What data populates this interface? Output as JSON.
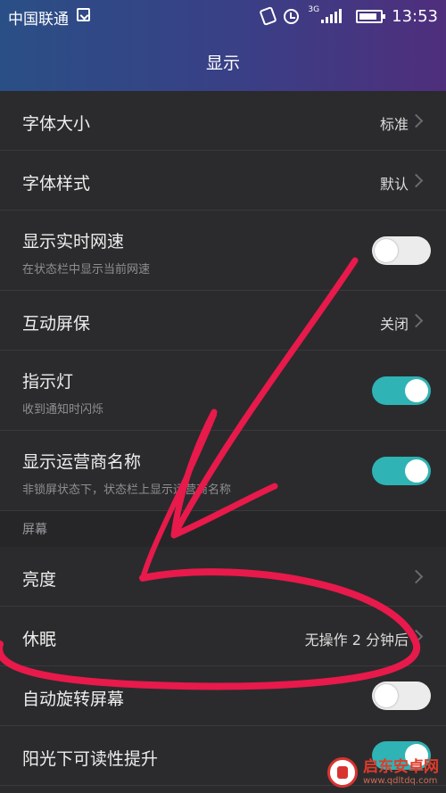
{
  "status_bar": {
    "carrier": "中国联通",
    "network_type": "3G",
    "time": "13:53",
    "battery_level": 0.85,
    "icons": [
      "sim-icon",
      "vibrate-icon",
      "alarm-icon",
      "signal-icon",
      "battery-icon"
    ]
  },
  "header": {
    "title": "显示",
    "gradient_colors": [
      "#2a4f86",
      "#4f2e7c"
    ]
  },
  "settings": [
    {
      "key": "font_size",
      "title": "字体大小",
      "value": "标准",
      "control": "chevron"
    },
    {
      "key": "font_style",
      "title": "字体样式",
      "value": "默认",
      "control": "chevron"
    },
    {
      "key": "show_net_speed",
      "title": "显示实时网速",
      "subtitle": "在状态栏中显示当前网速",
      "control": "switch",
      "enabled": false
    },
    {
      "key": "screensaver",
      "title": "互动屏保",
      "value": "关闭",
      "control": "chevron"
    },
    {
      "key": "indicator_light",
      "title": "指示灯",
      "subtitle": "收到通知时闪烁",
      "control": "switch",
      "enabled": true
    },
    {
      "key": "show_carrier",
      "title": "显示运营商名称",
      "subtitle": "非锁屏状态下，状态栏上显示运营商名称",
      "control": "switch",
      "enabled": true
    }
  ],
  "section_screen": {
    "label": "屏幕",
    "items": [
      {
        "key": "brightness",
        "title": "亮度",
        "control": "chevron"
      },
      {
        "key": "sleep",
        "title": "休眠",
        "value": "无操作 2 分钟后",
        "control": "chevron"
      },
      {
        "key": "auto_rotate",
        "title": "自动旋转屏幕",
        "control": "switch",
        "enabled": false
      },
      {
        "key": "sunlight",
        "title": "阳光下可读性提升",
        "control": "switch",
        "enabled": true
      }
    ]
  },
  "annotation": {
    "color": "#e8194b",
    "shapes": [
      "arrow",
      "ellipse"
    ]
  },
  "watermark": {
    "name": "启东安卓网",
    "url": "www.qdltdq.com"
  },
  "colors": {
    "background": "#2b2b2d",
    "switch_on": "#2fb3b4",
    "switch_off": "#ececec"
  }
}
